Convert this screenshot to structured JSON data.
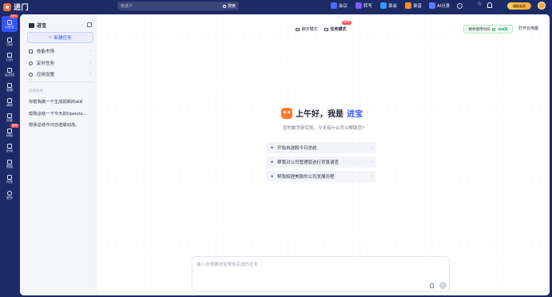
{
  "app": {
    "name": "进门"
  },
  "search": {
    "placeholder": "有道 F",
    "button_label": "搜索"
  },
  "top_nav": [
    {
      "label": "会议",
      "icon": "meeting-icon",
      "color": "#4a6cff"
    },
    {
      "label": "转写",
      "icon": "transcribe-icon",
      "color": "#7b5cff"
    },
    {
      "label": "录会",
      "icon": "record-meeting-icon",
      "color": "#2f9bff"
    },
    {
      "label": "录音",
      "icon": "recorder-icon",
      "color": "#ff8a2a"
    },
    {
      "label": "AI分身",
      "icon": "ai-avatar-icon",
      "color": "#5b7cff"
    }
  ],
  "vip_badge": "超级会员",
  "left_nav": [
    {
      "label": "AI进宝",
      "badge": "New"
    },
    {
      "label": "活动"
    },
    {
      "label": "日历"
    },
    {
      "label": "云文档"
    },
    {
      "label": "直播"
    },
    {
      "label": "调研"
    },
    {
      "label": "纪要"
    },
    {
      "label": "研报",
      "badge": "更新"
    },
    {
      "label": "必读"
    },
    {
      "label": "数据"
    },
    {
      "label": "问答"
    },
    {
      "label": "更多"
    }
  ],
  "sidebar": {
    "title": "进宝",
    "new_task_label": "新建任务",
    "menu": [
      {
        "label": "技能市场"
      },
      {
        "label": "定时任务"
      },
      {
        "label": "应用设置"
      }
    ],
    "history_title": "历史任务",
    "history": [
      "你帮我做一个生成视频的skill",
      "帮我总结一下今天的Opencla...",
      "帮我总结今日自选股动态。"
    ]
  },
  "header": {
    "mode_chat": "聊天模式",
    "mode_task": "任务模式",
    "mode_badge": "NEW",
    "free_time_label": "剩余使用时间",
    "free_time_value": "359天",
    "open_pc_label": "打开云电脑"
  },
  "welcome": {
    "greeting": "上午好，我是",
    "brand": "进宝",
    "subtitle": "您的数字研究员，今天有什么可以帮助您?"
  },
  "suggestions": [
    "开始自选股今日总结",
    "帮我对公司管理层进行背景调查",
    "帮我梳理美股的公司发展历程"
  ],
  "chat": {
    "placeholder": "输入你想要进宝帮你完成的任务"
  }
}
